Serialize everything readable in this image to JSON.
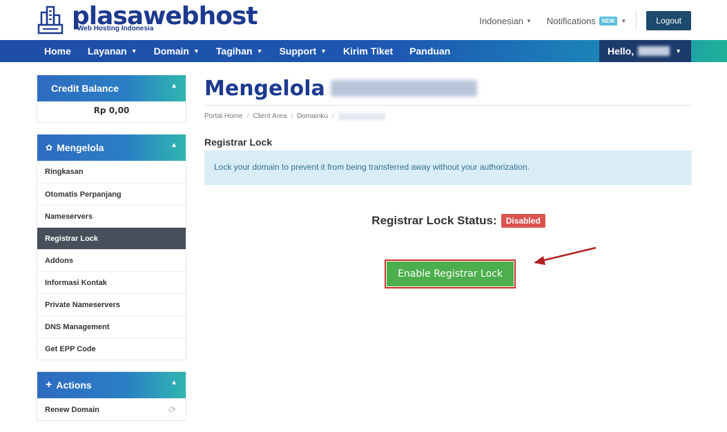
{
  "header": {
    "logo_name": "plasawebhost",
    "logo_tagline": "Web Hosting Indonesia",
    "language": "Indonesian",
    "notifications": "Notifications",
    "notifications_badge": "NEW",
    "logout": "Logout"
  },
  "nav": {
    "items": [
      {
        "label": "Home",
        "has_dropdown": false
      },
      {
        "label": "Layanan",
        "has_dropdown": true
      },
      {
        "label": "Domain",
        "has_dropdown": true
      },
      {
        "label": "Tagihan",
        "has_dropdown": true
      },
      {
        "label": "Support",
        "has_dropdown": true
      },
      {
        "label": "Kirim Tiket",
        "has_dropdown": false
      },
      {
        "label": "Panduan",
        "has_dropdown": false
      }
    ],
    "hello": "Hello,"
  },
  "sidebar": {
    "credit": {
      "title": "Credit Balance",
      "amount": "Rp 0,00"
    },
    "manage": {
      "title": "Mengelola",
      "items": [
        {
          "label": "Ringkasan",
          "active": false
        },
        {
          "label": "Otomatis Perpanjang",
          "active": false
        },
        {
          "label": "Nameservers",
          "active": false
        },
        {
          "label": "Registrar Lock",
          "active": true
        },
        {
          "label": "Addons",
          "active": false
        },
        {
          "label": "Informasi Kontak",
          "active": false
        },
        {
          "label": "Private Nameservers",
          "active": false
        },
        {
          "label": "DNS Management",
          "active": false
        },
        {
          "label": "Get EPP Code",
          "active": false
        }
      ]
    },
    "actions": {
      "title": "Actions",
      "items": [
        {
          "label": "Renew Domain"
        }
      ]
    }
  },
  "main": {
    "title": "Mengelola",
    "breadcrumb": [
      "Portal Home",
      "Client Area",
      "Domainku"
    ],
    "section_title": "Registrar Lock",
    "alert": "Lock your domain to prevent it from being transferred away without your authorization.",
    "status_label": "Registrar Lock Status:",
    "status_value": "Disabled",
    "button_label": "Enable Registrar Lock"
  },
  "colors": {
    "brand": "#1d3a8f",
    "success": "#4cae4c",
    "danger": "#d9534f",
    "info_bg": "#d9edf7"
  }
}
